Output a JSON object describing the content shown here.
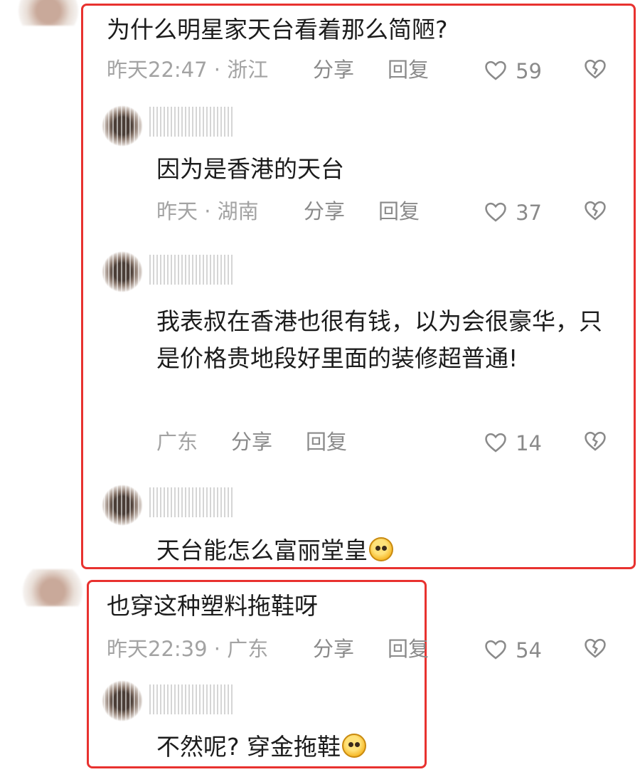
{
  "comment_1": {
    "text": "为什么明星家天台看着那么简陋?",
    "time_location": "昨天22:47 · 浙江",
    "share": "分享",
    "reply": "回复",
    "likes": "59",
    "replies": [
      {
        "text": "因为是香港的天台",
        "time_location": "昨天 · 湖南",
        "share": "分享",
        "reply": "回复",
        "likes": "37"
      },
      {
        "text": "我表叔在香港也很有钱，以为会很豪华，只是价格贵地段好里面的装修超普通!",
        "time_location": "广东",
        "share": "分享",
        "reply": "回复",
        "likes": "14"
      },
      {
        "text": "天台能怎么富丽堂皇",
        "emoji": "astonished-face-emoji"
      }
    ]
  },
  "comment_2": {
    "text": "也穿这种塑料拖鞋呀",
    "time_location": "昨天22:39 · 广东",
    "share": "分享",
    "reply": "回复",
    "likes": "54",
    "replies": [
      {
        "text": "不然呢? 穿金拖鞋",
        "emoji": "rolling-laughing-face-emoji"
      }
    ]
  },
  "icons": {
    "like": "heart-outline-icon",
    "dislike": "broken-heart-icon"
  },
  "colors": {
    "highlight_box": "#e8322f",
    "meta_text": "#a3a3a3",
    "action_text": "#8a8a8a"
  }
}
